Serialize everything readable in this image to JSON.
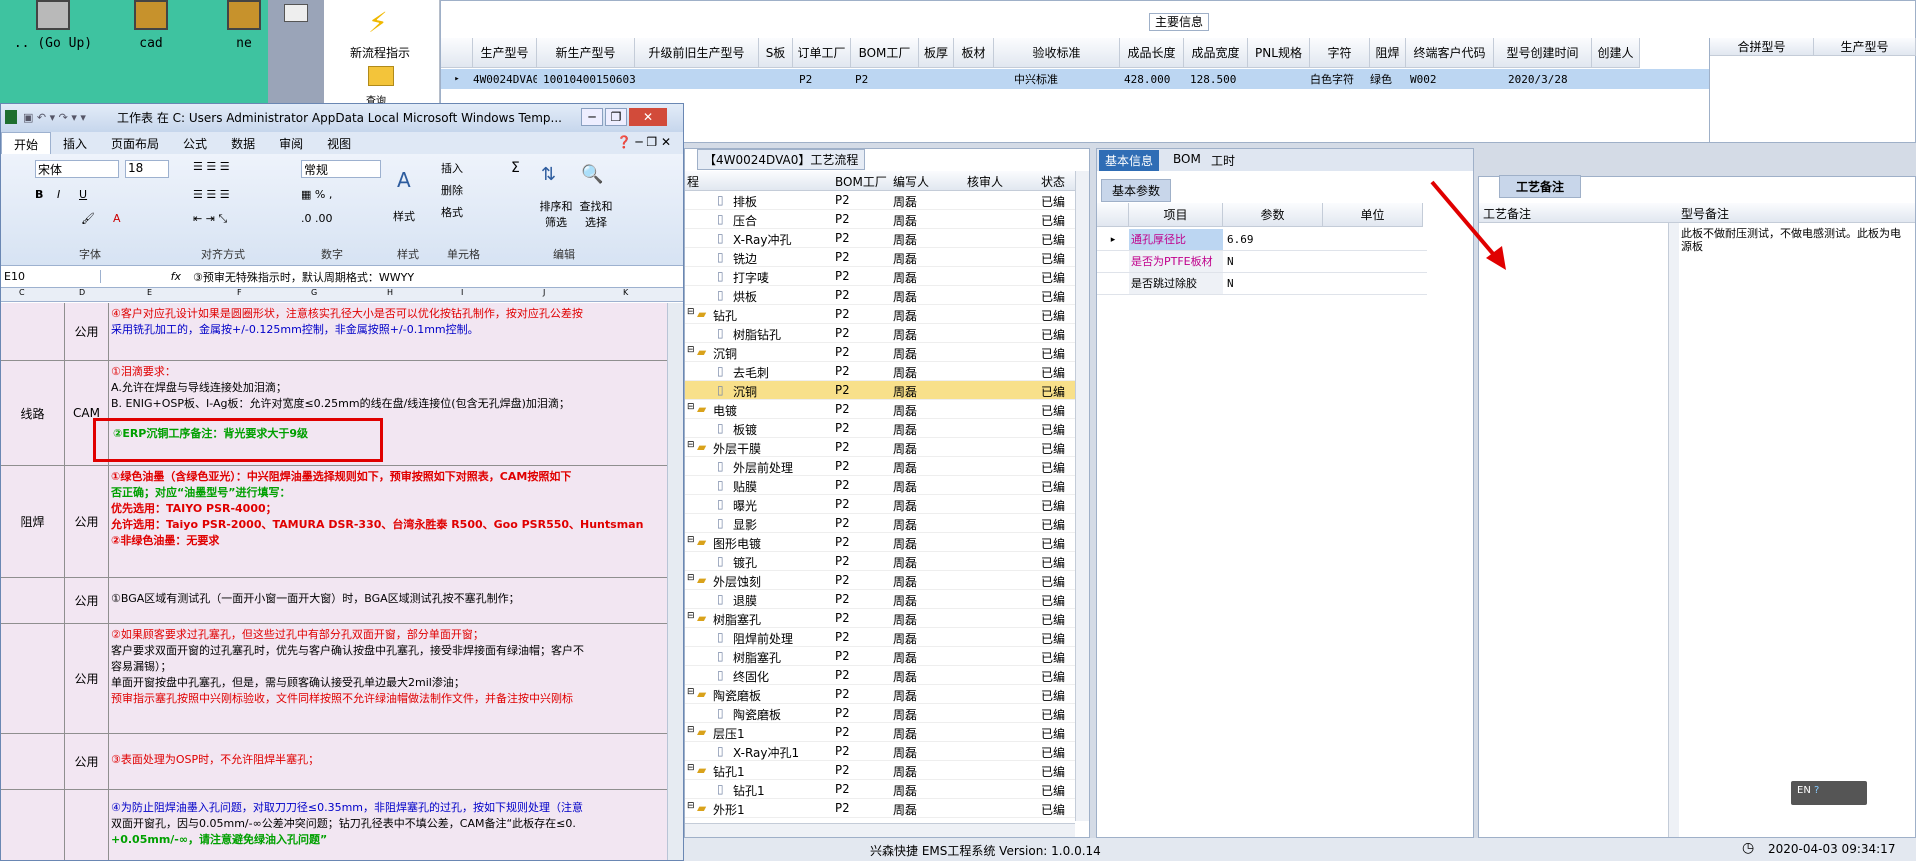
{
  "desktop": {
    "icons": [
      {
        "label": ".. (Go Up)"
      },
      {
        "label": "cad"
      },
      {
        "label": "ne"
      }
    ]
  },
  "flow": {
    "label1": "新流程指示",
    "label2": "查询"
  },
  "main": {
    "title": "主要信息",
    "columns": [
      "生产型号",
      "新生产型号",
      "升级前旧生产型号",
      "S板",
      "订单工厂",
      "BOM工厂",
      "板厚",
      "板材",
      "验收标准",
      "成品长度",
      "成品宽度",
      "PNL规格",
      "字符",
      "阻焊",
      "终端客户代码",
      "型号创建时间",
      "创建人"
    ],
    "row": [
      "4W0024DVA0",
      "10010400150603",
      "",
      "",
      "P2",
      "P2",
      "",
      "",
      "中兴标准",
      "428.000",
      "128.500",
      "",
      "白色字符",
      "绿色",
      "W002",
      "2020/3/28",
      ""
    ],
    "side_columns": [
      "合拼型号",
      "生产型号"
    ]
  },
  "excel": {
    "title": "工作表 在 C: Users Administrator AppData Local Microsoft Windows Temp...",
    "tabs": [
      "开始",
      "插入",
      "页面布局",
      "公式",
      "数据",
      "审阅",
      "视图"
    ],
    "font": "宋体",
    "size": "18",
    "format": "常规",
    "groups": [
      "字体",
      "对齐方式",
      "数字",
      "样式",
      "单元格",
      "编辑"
    ],
    "cmds": {
      "insert": "插入",
      "delete": "删除",
      "format": "格式",
      "style": "样式",
      "sort": "排序和筛选",
      "find": "查找和选择"
    },
    "cellref": "E10",
    "formula": "③预审无特殊指示时，默认周期格式：WWYY",
    "colhdr": [
      "C",
      "D",
      "E",
      "F",
      "G",
      "H",
      "I",
      "J",
      "K"
    ],
    "rows": [
      {
        "c1": "",
        "c2": "公用",
        "lines": [
          "④客户对应孔设计如果是圆圈形状，注意核实孔径大小是否可以优化按钻孔制作，按对应孔公差按",
          "采用铣孔加工的，金属按+/-0.125mm控制，非金属按照+/-0.1mm控制。"
        ]
      },
      {
        "c1": "线路",
        "c2": "CAM",
        "lines": [
          "①泪滴要求：",
          "A.允许在焊盘与导线连接处加泪滴；",
          "B. ENIG+OSP板、I-Ag板：允许对宽度≤0.25mm的线在盘/线连接位(包含无孔焊盘)加泪滴；"
        ],
        "boxed": "②ERP沉铜工序备注：背光要求大于9级"
      },
      {
        "c1": "阻焊",
        "c2": "公用",
        "lines": [
          "①绿色油墨（含绿色亚光）：中兴阻焊油墨选择规则如下，预审按照如下对照表，CAM按照如下",
          "否正确；对应“油墨型号”进行填写：",
          "优先选用：TAIYO PSR-4000；",
          "允许选用：Taiyo PSR-2000、TAMURA DSR-330、台湾永胜泰 R500、Goo PSR550、Huntsman",
          "",
          "②非绿色油墨：无要求"
        ]
      },
      {
        "c1": "",
        "c2": "公用",
        "lines": [
          "①BGA区域有测试孔（一面开小窗一面开大窗）时，BGA区域测试孔按不塞孔制作；"
        ]
      },
      {
        "c1": "",
        "c2": "公用",
        "lines": [
          "②如果顾客要求过孔塞孔，但这些过孔中有部分孔双面开窗，部分单面开窗；",
          "客户要求双面开窗的过孔塞孔时，优先与客户确认按盘中孔塞孔，接受非焊接面有绿油帽；客户不",
          "容易漏锡）；",
          "单面开窗按盘中孔塞孔，但是，需与顾客确认接受孔单边最大2mil渗油；",
          "",
          "预审指示塞孔按照中兴刚标验收，文件同样按照不允许绿油帽做法制作文件，并备注按中兴刚标"
        ]
      },
      {
        "c1": "",
        "c2": "公用",
        "lines": [
          "③表面处理为OSP时，不允许阻焊半塞孔；"
        ]
      },
      {
        "c1": "",
        "c2": "",
        "lines": [
          "④为防止阻焊油墨入孔问题，对取刀刀径≤0.35mm，非阻焊塞孔的过孔，按如下规则处理（注意",
          "双面开窗孔，因与0.05mm/-∞公差冲突问题；钻刀孔径表中不填公差，CAM备注“此板存在≤0.",
          "+0.05mm/-∞，请注意避免绿油入孔问题”"
        ]
      }
    ]
  },
  "tree": {
    "title": "【4W0024DVA0】工艺流程",
    "columns": [
      "程",
      "BOM工厂",
      "编写人",
      "核审人",
      "状态"
    ],
    "rows": [
      {
        "name": "排板",
        "level": 2,
        "f": "P2",
        "w": "周磊",
        "s": "已编"
      },
      {
        "name": "压合",
        "level": 2,
        "f": "P2",
        "w": "周磊",
        "s": "已编"
      },
      {
        "name": "X-Ray冲孔",
        "level": 2,
        "f": "P2",
        "w": "周磊",
        "s": "已编"
      },
      {
        "name": "铣边",
        "level": 2,
        "f": "P2",
        "w": "周磊",
        "s": "已编"
      },
      {
        "name": "打字唛",
        "level": 2,
        "f": "P2",
        "w": "周磊",
        "s": "已编"
      },
      {
        "name": "烘板",
        "level": 2,
        "f": "P2",
        "w": "周磊",
        "s": "已编"
      },
      {
        "name": "钻孔",
        "level": 1,
        "f": "P2",
        "w": "周磊",
        "s": "已编"
      },
      {
        "name": "树脂钻孔",
        "level": 2,
        "f": "P2",
        "w": "周磊",
        "s": "已编"
      },
      {
        "name": "沉铜",
        "level": 1,
        "f": "P2",
        "w": "周磊",
        "s": "已编"
      },
      {
        "name": "去毛刺",
        "level": 2,
        "f": "P2",
        "w": "周磊",
        "s": "已编"
      },
      {
        "name": "沉铜",
        "level": 2,
        "f": "P2",
        "w": "周磊",
        "s": "已编",
        "sel": true
      },
      {
        "name": "电镀",
        "level": 1,
        "f": "P2",
        "w": "周磊",
        "s": "已编"
      },
      {
        "name": "板镀",
        "level": 2,
        "f": "P2",
        "w": "周磊",
        "s": "已编"
      },
      {
        "name": "外层干膜",
        "level": 1,
        "f": "P2",
        "w": "周磊",
        "s": "已编"
      },
      {
        "name": "外层前处理",
        "level": 2,
        "f": "P2",
        "w": "周磊",
        "s": "已编"
      },
      {
        "name": "贴膜",
        "level": 2,
        "f": "P2",
        "w": "周磊",
        "s": "已编"
      },
      {
        "name": "曝光",
        "level": 2,
        "f": "P2",
        "w": "周磊",
        "s": "已编"
      },
      {
        "name": "显影",
        "level": 2,
        "f": "P2",
        "w": "周磊",
        "s": "已编"
      },
      {
        "name": "图形电镀",
        "level": 1,
        "f": "P2",
        "w": "周磊",
        "s": "已编"
      },
      {
        "name": "镀孔",
        "level": 2,
        "f": "P2",
        "w": "周磊",
        "s": "已编"
      },
      {
        "name": "外层蚀刻",
        "level": 1,
        "f": "P2",
        "w": "周磊",
        "s": "已编"
      },
      {
        "name": "退膜",
        "level": 2,
        "f": "P2",
        "w": "周磊",
        "s": "已编"
      },
      {
        "name": "树脂塞孔",
        "level": 1,
        "f": "P2",
        "w": "周磊",
        "s": "已编"
      },
      {
        "name": "阻焊前处理",
        "level": 2,
        "f": "P2",
        "w": "周磊",
        "s": "已编"
      },
      {
        "name": "树脂塞孔",
        "level": 2,
        "f": "P2",
        "w": "周磊",
        "s": "已编"
      },
      {
        "name": "终固化",
        "level": 2,
        "f": "P2",
        "w": "周磊",
        "s": "已编"
      },
      {
        "name": "陶瓷磨板",
        "level": 1,
        "f": "P2",
        "w": "周磊",
        "s": "已编"
      },
      {
        "name": "陶瓷磨板",
        "level": 2,
        "f": "P2",
        "w": "周磊",
        "s": "已编"
      },
      {
        "name": "层压1",
        "level": 1,
        "f": "P2",
        "w": "周磊",
        "s": "已编"
      },
      {
        "name": "X-Ray冲孔1",
        "level": 2,
        "f": "P2",
        "w": "周磊",
        "s": "已编"
      },
      {
        "name": "钻孔1",
        "level": 1,
        "f": "P2",
        "w": "周磊",
        "s": "已编"
      },
      {
        "name": "钻孔1",
        "level": 2,
        "f": "P2",
        "w": "周磊",
        "s": "已编"
      },
      {
        "name": "外形1",
        "level": 1,
        "f": "P2",
        "w": "周磊",
        "s": "已编"
      }
    ]
  },
  "basic": {
    "tabs": [
      "基本信息",
      "BOM",
      "工时"
    ],
    "subtab": "基本参数",
    "columns": [
      "项目",
      "参数",
      "单位"
    ],
    "rows": [
      {
        "item": "通孔厚径比",
        "val": "6.69",
        "unit": ""
      },
      {
        "item": "是否为PTFE板材",
        "val": "N",
        "unit": ""
      },
      {
        "item": "是否跳过除胶",
        "val": "N",
        "unit": ""
      }
    ]
  },
  "craft": {
    "tab": "工艺备注",
    "col1": "工艺备注",
    "col2": "型号备注",
    "note": "此板不做耐压测试，不做电感测试。此板为电源板"
  },
  "status": {
    "app": "兴森快捷 EMS工程系统 Version: 1.0.0.14",
    "time": "2020-04-03 09:34:17",
    "ime": "EN"
  }
}
